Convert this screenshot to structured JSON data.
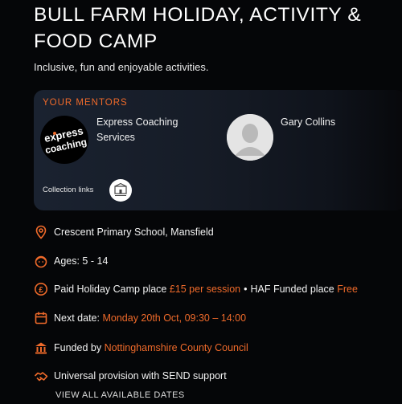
{
  "page": {
    "title": "BULL FARM HOLIDAY, ACTIVITY & FOOD CAMP",
    "subtitle": "Inclusive, fun and enjoyable activities."
  },
  "mentors": {
    "heading": "YOUR MENTORS",
    "items": [
      {
        "name_line1": "Express Coaching",
        "name_line2": "Services",
        "logo_text_1": "express",
        "logo_text_2": "coaching"
      },
      {
        "name": "Gary Collins"
      }
    ],
    "collection_label": "Collection links"
  },
  "info": {
    "location": "Crescent Primary School, Mansfield",
    "ages": "Ages: 5 - 14",
    "paid_label": "Paid Holiday Camp place",
    "paid_price": "£15 per session",
    "separator": "•",
    "haf_label": "HAF Funded place",
    "haf_price": "Free",
    "next_label": "Next date:",
    "next_value": "Monday 20th Oct, 09:30 – 14:00",
    "funded_label": "Funded by",
    "funded_value": "Nottinghamshire County Council",
    "provision": "Universal provision with SEND support"
  },
  "actions": {
    "view_all": "VIEW ALL AVAILABLE DATES"
  },
  "colors": {
    "accent": "#ef6a2a",
    "background": "#050608",
    "card": "#1a2230"
  }
}
